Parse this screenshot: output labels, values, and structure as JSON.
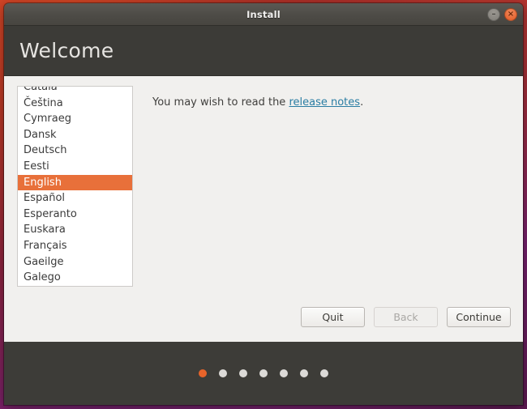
{
  "window": {
    "titlebar": {
      "title": "Install",
      "buttons": [
        {
          "name": "minimize",
          "glyph": "–"
        },
        {
          "name": "close",
          "glyph": "×"
        }
      ]
    },
    "header": {
      "title": "Welcome"
    }
  },
  "language_list": {
    "items": [
      {
        "label": "Català",
        "selected": false
      },
      {
        "label": "Čeština",
        "selected": false
      },
      {
        "label": "Cymraeg",
        "selected": false
      },
      {
        "label": "Dansk",
        "selected": false
      },
      {
        "label": "Deutsch",
        "selected": false
      },
      {
        "label": "Eesti",
        "selected": false
      },
      {
        "label": "English",
        "selected": true
      },
      {
        "label": "Español",
        "selected": false
      },
      {
        "label": "Esperanto",
        "selected": false
      },
      {
        "label": "Euskara",
        "selected": false
      },
      {
        "label": "Français",
        "selected": false
      },
      {
        "label": "Gaeilge",
        "selected": false
      },
      {
        "label": "Galego",
        "selected": false
      }
    ],
    "selected_value": "English"
  },
  "main": {
    "release_text_before": "You may wish to read the ",
    "release_link": "release notes",
    "release_text_after": "."
  },
  "buttons": {
    "quit": "Quit",
    "back": "Back",
    "continue": "Continue"
  },
  "progress": {
    "total_steps": 7,
    "active_step": 1
  },
  "colors": {
    "accent_orange": "#e8703a",
    "dot_active": "#e8642a",
    "link_blue": "#2a7da3",
    "header_dark": "#3c3b37",
    "content_bg": "#f1f0ee",
    "desktop_purple": "#77216f"
  }
}
